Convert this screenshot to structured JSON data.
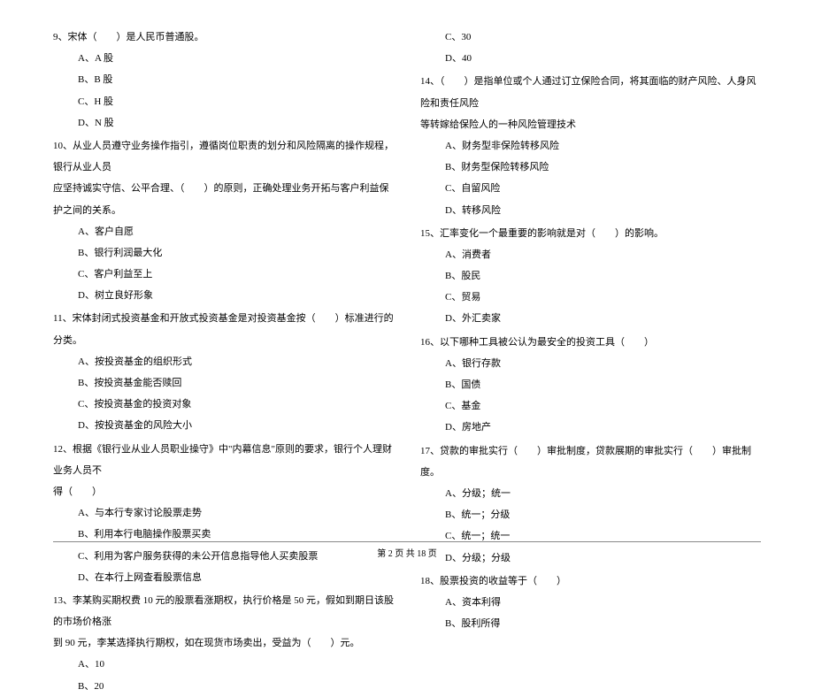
{
  "left": {
    "q9": {
      "text": "9、宋体（　　）是人民币普通股。",
      "a": "A、A 股",
      "b": "B、B 股",
      "c": "C、H 股",
      "d": "D、N 股"
    },
    "q10": {
      "text1": "10、从业人员遵守业务操作指引，遵循岗位职责的划分和风险隔离的操作规程，银行从业人员",
      "text2": "应坚持诚实守信、公平合理、（　　）的原则，正确处理业务开拓与客户利益保护之间的关系。",
      "a": "A、客户自愿",
      "b": "B、银行利润最大化",
      "c": "C、客户利益至上",
      "d": "D、树立良好形象"
    },
    "q11": {
      "text": "11、宋体封闭式投资基金和开放式投资基金是对投资基金按（　　）标准进行的分类。",
      "a": "A、按投资基金的组织形式",
      "b": "B、按投资基金能否赎回",
      "c": "C、按投资基金的投资对象",
      "d": "D、按投资基金的风险大小"
    },
    "q12": {
      "text1": "12、根据《银行业从业人员职业操守》中\"内幕信息\"原则的要求，银行个人理财业务人员不",
      "text2": "得（　　）",
      "a": "A、与本行专家讨论股票走势",
      "b": "B、利用本行电脑操作股票买卖",
      "c": "C、利用为客户服务获得的未公开信息指导他人买卖股票",
      "d": "D、在本行上网查看股票信息"
    },
    "q13": {
      "text1": "13、李某购买期权费 10 元的股票看涨期权，执行价格是 50 元，假如到期日该股的市场价格涨",
      "text2": "到 90 元，李某选择执行期权，如在现货市场卖出，受益为（　　）元。",
      "a": "A、10",
      "b": "B、20"
    }
  },
  "right": {
    "q13cont": {
      "c": "C、30",
      "d": "D、40"
    },
    "q14": {
      "text1": "14、（　　）是指单位或个人通过订立保险合同，将其面临的财产风险、人身风险和责任风险",
      "text2": "等转嫁给保险人的一种风险管理技术",
      "a": "A、财务型非保险转移风险",
      "b": "B、财务型保险转移风险",
      "c": "C、自留风险",
      "d": "D、转移风险"
    },
    "q15": {
      "text": "15、汇率变化一个最重要的影响就是对（　　）的影响。",
      "a": "A、消费者",
      "b": "B、股民",
      "c": "C、贸易",
      "d": "D、外汇卖家"
    },
    "q16": {
      "text": "16、以下哪种工具被公认为最安全的投资工具（　　）",
      "a": "A、银行存款",
      "b": "B、国债",
      "c": "C、基金",
      "d": "D、房地产"
    },
    "q17": {
      "text": "17、贷款的审批实行（　　）审批制度，贷款展期的审批实行（　　）审批制度。",
      "a": "A、分级；统一",
      "b": "B、统一；分级",
      "c": "C、统一；统一",
      "d": "D、分级；分级"
    },
    "q18": {
      "text": "18、股票投资的收益等于（　　）",
      "a": "A、资本利得",
      "b": "B、股利所得"
    }
  },
  "footer": "第 2 页 共 18 页"
}
